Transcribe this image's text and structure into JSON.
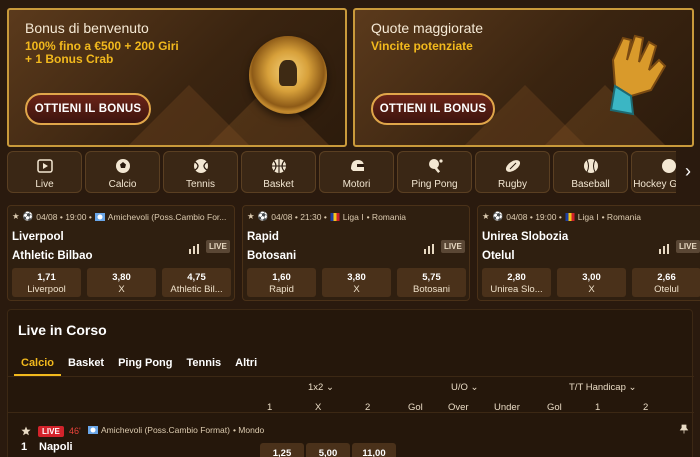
{
  "banners": [
    {
      "title": "Bonus di benvenuto",
      "subtitle_line1": "100% fino a €500 + 200 Giri",
      "subtitle_line2": "+ 1 Bonus Crab",
      "cta": "OTTIENI IL BONUS"
    },
    {
      "title": "Quote maggiorate",
      "subtitle_line1": "Vincite potenziate",
      "subtitle_line2": "",
      "cta": "OTTIENI IL BONUS"
    }
  ],
  "sports": [
    {
      "label": "Live",
      "icon": "live-play-icon"
    },
    {
      "label": "Calcio",
      "icon": "soccer-ball-icon"
    },
    {
      "label": "Tennis",
      "icon": "tennis-ball-icon"
    },
    {
      "label": "Basket",
      "icon": "basketball-icon"
    },
    {
      "label": "Motori",
      "icon": "helmet-icon"
    },
    {
      "label": "Ping Pong",
      "icon": "ping-pong-icon"
    },
    {
      "label": "Rugby",
      "icon": "rugby-ball-icon"
    },
    {
      "label": "Baseball",
      "icon": "baseball-icon"
    },
    {
      "label": "Hockey Ghiac...",
      "icon": "hockey-puck-icon"
    }
  ],
  "matches": [
    {
      "date": "04/08 • 19:00 •",
      "league": "Amichevoli (Poss.Cambio For...",
      "country": "",
      "team1": "Liverpool",
      "team2": "Athletic Bilbao",
      "live": "LIVE",
      "odds": [
        {
          "value": "1,71",
          "label": "Liverpool"
        },
        {
          "value": "3,80",
          "label": "X"
        },
        {
          "value": "4,75",
          "label": "Athletic Bil..."
        }
      ]
    },
    {
      "date": "04/08 • 21:30 •",
      "league": "Liga I",
      "country": "• Romania",
      "team1": "Rapid",
      "team2": "Botosani",
      "live": "LIVE",
      "odds": [
        {
          "value": "1,60",
          "label": "Rapid"
        },
        {
          "value": "3,80",
          "label": "X"
        },
        {
          "value": "5,75",
          "label": "Botosani"
        }
      ]
    },
    {
      "date": "04/08 • 19:00 •",
      "league": "Liga I",
      "country": "• Romania",
      "team1": "Unirea Slobozia",
      "team2": "Otelul",
      "live": "LIVE",
      "odds": [
        {
          "value": "2,80",
          "label": "Unirea Slo..."
        },
        {
          "value": "3,00",
          "label": "X"
        },
        {
          "value": "2,66",
          "label": "Otelul"
        }
      ]
    }
  ],
  "live_section": {
    "title": "Live in Corso",
    "tabs": [
      "Calcio",
      "Basket",
      "Ping Pong",
      "Tennis",
      "Altri"
    ],
    "active_tab": "Calcio",
    "market_groups": [
      "1x2",
      "U/O",
      "T/T Handicap"
    ],
    "headers_1x2": [
      "1",
      "X",
      "2"
    ],
    "headers_uo": [
      "Gol",
      "Over",
      "Under"
    ],
    "headers_tt": [
      "Gol",
      "1",
      "2"
    ],
    "row": {
      "live": "LIVE",
      "minute": "46'",
      "league": "Amichevoli (Poss.Cambio Format)",
      "country": "• Mondo",
      "number": "1",
      "team": "Napoli",
      "odds": [
        "1,25",
        "5,00",
        "11,00"
      ]
    }
  },
  "colors": {
    "accent": "#f2b91d",
    "live_red": "#d3232b",
    "card_bg": "#2f1f10",
    "odd_bg": "#4a311a"
  }
}
